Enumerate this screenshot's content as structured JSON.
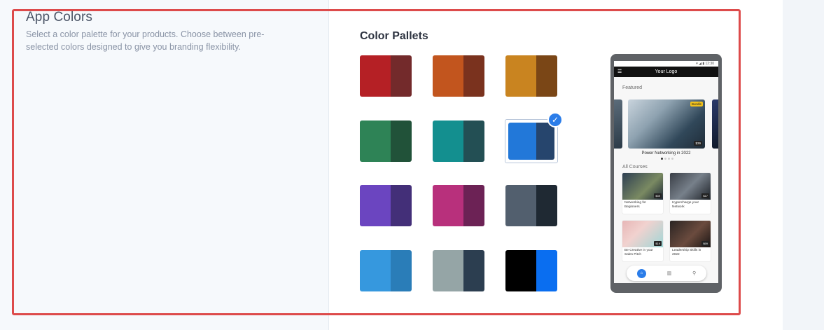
{
  "section": {
    "title": "App Colors",
    "description": "Select a color palette for your products. Choose between pre-selected colors designed to give you branding flexibility."
  },
  "palettes": {
    "title": "Color Pallets",
    "selected_index": 5,
    "items": [
      {
        "primary": "#b52025",
        "secondary": "#732a2b"
      },
      {
        "primary": "#c2551e",
        "secondary": "#7a321e"
      },
      {
        "primary": "#c98420",
        "secondary": "#7a4616"
      },
      {
        "primary": "#2e8356",
        "secondary": "#215239"
      },
      {
        "primary": "#138f8f",
        "secondary": "#234f54"
      },
      {
        "primary": "#2278d9",
        "secondary": "#26456d"
      },
      {
        "primary": "#6b45c0",
        "secondary": "#432f78"
      },
      {
        "primary": "#b8307c",
        "secondary": "#6c2255"
      },
      {
        "primary": "#525f6e",
        "secondary": "#1f2933"
      },
      {
        "primary": "#3698de",
        "secondary": "#2a7db8"
      },
      {
        "primary": "#95a5a6",
        "secondary": "#2c3e50"
      },
      {
        "primary": "#000000",
        "secondary": "#0a6ef0"
      }
    ]
  },
  "preview": {
    "status_time": "12:30",
    "app_bar_title": "Your Logo",
    "featured_label": "Featured",
    "featured_course": {
      "title": "Power Networking in 2022",
      "price": "$39",
      "tag": "Bundle"
    },
    "all_courses_label": "All Courses",
    "courses": [
      {
        "name": "Networking for Beginners",
        "price": "$39"
      },
      {
        "name": "Hypercharge your Network",
        "price": "$17"
      },
      {
        "name": "Be Creative in your Sales Pitch",
        "price": "$19"
      },
      {
        "name": "Leadership Skills in 2022",
        "price": "$69"
      }
    ],
    "nav_icons": [
      "home-icon",
      "book-icon",
      "search-icon"
    ]
  },
  "colors": {
    "highlight_border": "#dd4b4b",
    "check_badge": "#2b7de9"
  }
}
